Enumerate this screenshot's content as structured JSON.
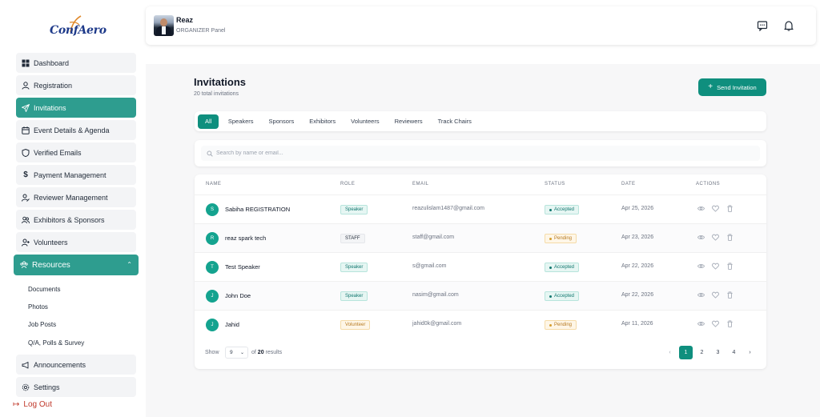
{
  "brand": {
    "logo_text": "ConfAero"
  },
  "sidebar": {
    "items": [
      {
        "label": "Dashboard",
        "icon": "grid-icon"
      },
      {
        "label": "Registration",
        "icon": "user-icon"
      },
      {
        "label": "Invitations",
        "icon": "send-icon"
      },
      {
        "label": "Event Details & Agenda",
        "icon": "calendar-icon"
      },
      {
        "label": "Verified Emails",
        "icon": "shield-icon"
      },
      {
        "label": "Payment Management",
        "icon": "dollar-icon"
      },
      {
        "label": "Reviewer Management",
        "icon": "user-edit-icon"
      },
      {
        "label": "Exhibitors & Sponsors",
        "icon": "users-icon"
      },
      {
        "label": "Volunteers",
        "icon": "user-plus-icon"
      }
    ],
    "resources": {
      "label": "Resources",
      "sub_items": [
        "Documents",
        "Photos",
        "Job Posts",
        "Q/A, Polls & Survey"
      ]
    },
    "bottom_items": [
      {
        "label": "Announcements",
        "icon": "megaphone-icon"
      },
      {
        "label": "Settings",
        "icon": "gear-icon"
      }
    ],
    "logout": "Log Out"
  },
  "header": {
    "user_name": "Reaz",
    "user_role": "ORGANIZER Panel"
  },
  "page": {
    "title": "Invitations",
    "subtitle": "20 total invitations",
    "send_button": "Send Invitation"
  },
  "tabs": [
    "All",
    "Speakers",
    "Sponsors",
    "Exhibitors",
    "Volunteers",
    "Reviewers",
    "Track Chairs"
  ],
  "search": {
    "placeholder": "Search by name or email..."
  },
  "table": {
    "headers": [
      "NAME",
      "ROLE",
      "EMAIL",
      "STATUS",
      "DATE",
      "ACTIONS"
    ],
    "rows": [
      {
        "initial": "S",
        "name": "Sabiha REGISTRATION",
        "role": "Speaker",
        "email": "reazulislam1487@gmail.com",
        "status": "Accepted",
        "date": "Apr 25, 2026"
      },
      {
        "initial": "R",
        "name": "reaz spark tech",
        "role": "STAFF",
        "email": "staff@gmail.com",
        "status": "Pending",
        "date": "Apr 23, 2026"
      },
      {
        "initial": "T",
        "name": "Test Speaker",
        "role": "Speaker",
        "email": "s@gmail.com",
        "status": "Accepted",
        "date": "Apr 22, 2026"
      },
      {
        "initial": "J",
        "name": "John Doe",
        "role": "Speaker",
        "email": "nasim@gmail.com",
        "status": "Accepted",
        "date": "Apr 22, 2026"
      },
      {
        "initial": "J",
        "name": "Jahid",
        "role": "Volunteer",
        "email": "jahid0k@gmail.com",
        "status": "Pending",
        "date": "Apr 11, 2026"
      }
    ]
  },
  "pagination": {
    "show_label": "Show",
    "per_page": "9",
    "results_prefix": "of",
    "total": "20",
    "results_suffix": "results",
    "pages": [
      "1",
      "2",
      "3",
      "4"
    ],
    "current": "1"
  },
  "colors": {
    "accent": "#0f8f7e",
    "sidebar_active": "#2e9d8f",
    "logout": "#c0392b"
  }
}
